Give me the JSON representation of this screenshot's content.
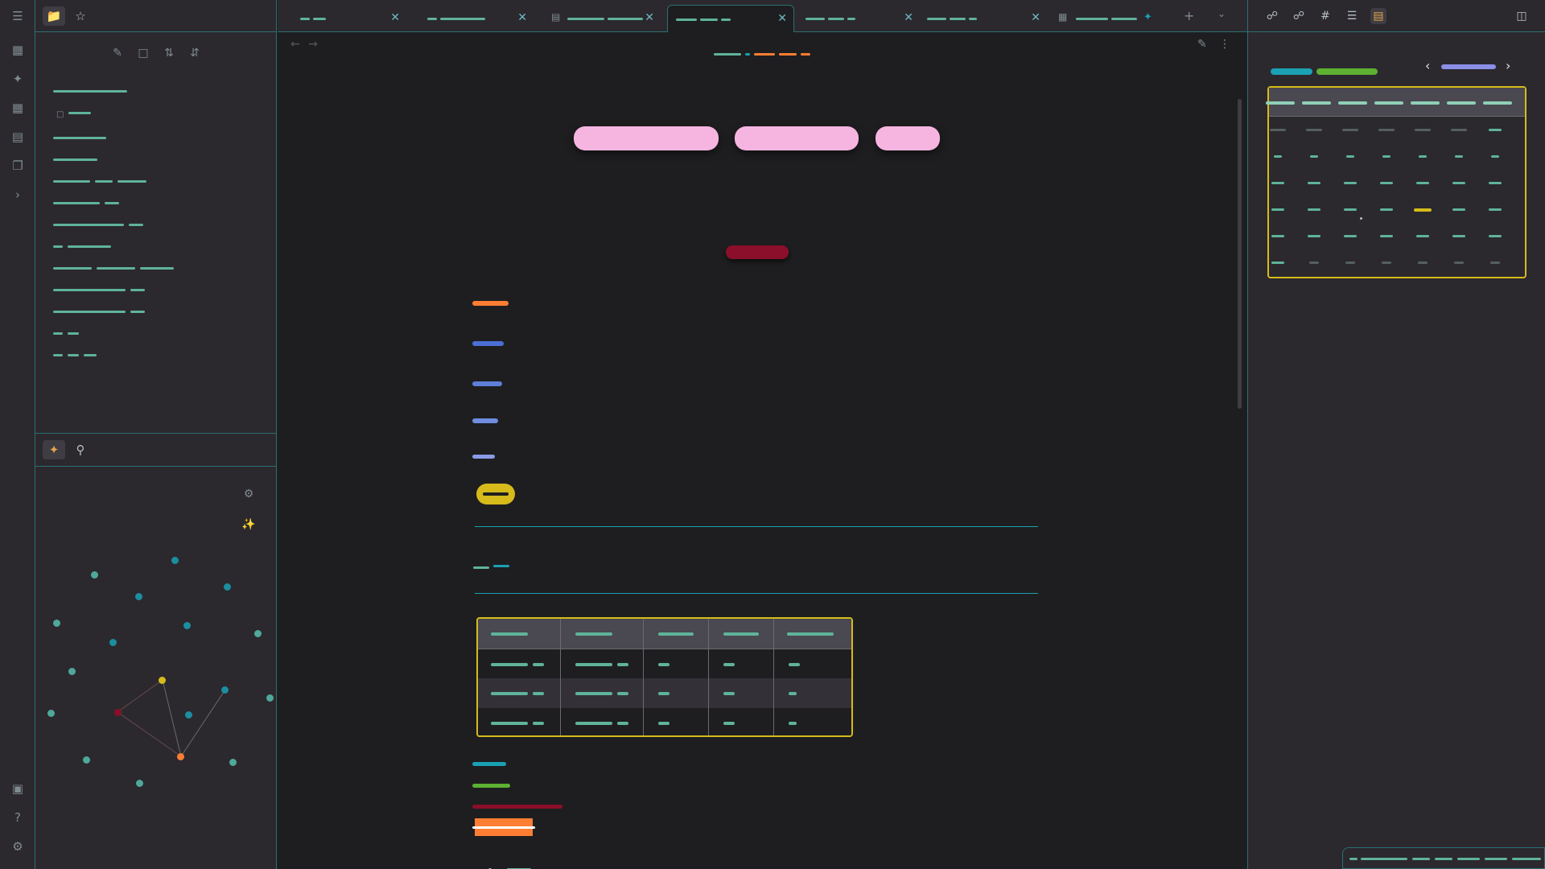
{
  "tabs": [
    {
      "label": "— —",
      "active": false
    },
    {
      "label": "— ———",
      "active": false
    },
    {
      "label": "——— ———",
      "active": false
    },
    {
      "label": "—— —— —",
      "active": true
    },
    {
      "label": "—— —— —",
      "active": false
    },
    {
      "label": "—— —— —",
      "active": false
    },
    {
      "label": "———— ——",
      "active": false
    }
  ],
  "sidebar": {
    "file_tree_label": "File explorer",
    "bookmarks_label": "Bookmarks",
    "nav_actions": [
      "new-note",
      "new-folder",
      "sort",
      "collapse-all"
    ],
    "graph_tab": "Local graph",
    "search_tab": "Search"
  },
  "main": {
    "inline_title_parts": [
      "— —",
      "— —"
    ],
    "pills": [
      "",
      "",
      ""
    ],
    "heading_red": "",
    "heading_levels": [
      "h1",
      "h2",
      "h3",
      "h4",
      "h5"
    ]
  },
  "colors": {
    "accent": "#2a6f73",
    "teal_text": "#5fb39a",
    "yellow": "#d6bb1b",
    "pink": "#f6b5e0",
    "orange": "#fd7e33",
    "red": "#8b0f2a",
    "blue": "#4c6fd6",
    "green": "#5db032"
  },
  "calendar": {
    "weekday_headers": 7,
    "month_title_color": "#8b8fe8"
  }
}
